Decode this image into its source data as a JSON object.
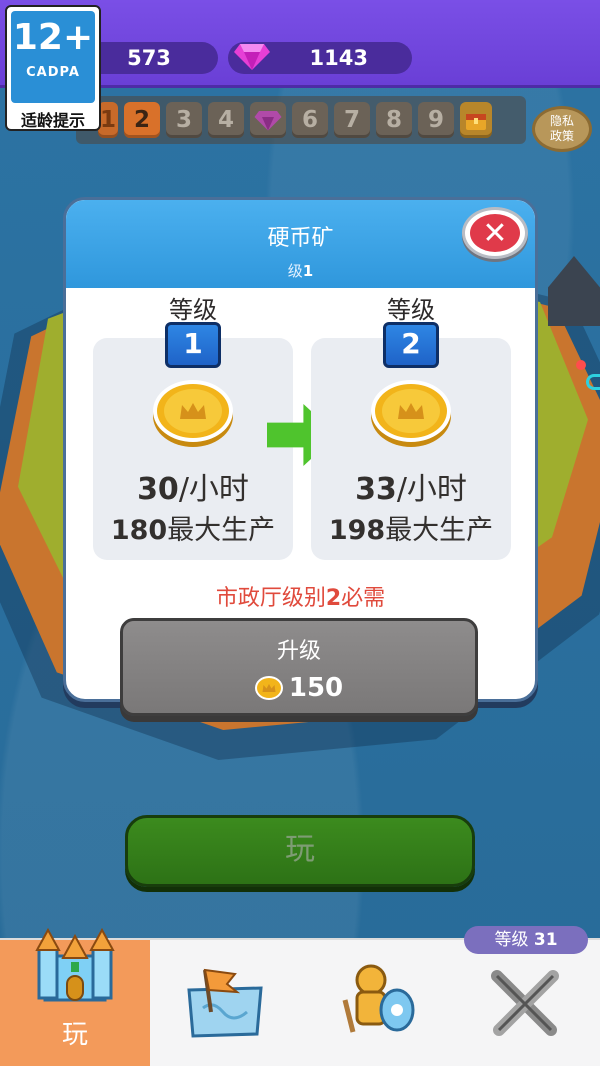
{
  "age_rating": {
    "number": "12+",
    "org": "CADPA",
    "tip": "适龄提示"
  },
  "resources": {
    "coins": "573",
    "gems": "1143"
  },
  "level_strip": {
    "cells": [
      "1",
      "2",
      "3",
      "4",
      "",
      "6",
      "7",
      "8",
      "9",
      ""
    ],
    "current": "2",
    "gem_cell_icon": "gem-icon",
    "chest_cell_icon": "chest-icon"
  },
  "privacy_button": "隐私政策",
  "modal": {
    "title": "硬币矿",
    "subtitle_prefix": "级",
    "subtitle_level": "1",
    "current": {
      "label": "等级",
      "level": "1",
      "rate_value": "30",
      "rate_unit": "/小时",
      "max_value": "180",
      "max_label": "最大生产"
    },
    "next": {
      "label": "等级",
      "level": "2",
      "rate_value": "33",
      "rate_unit": "/小时",
      "max_value": "198",
      "max_label": "最大生产"
    },
    "requirement_prefix": "市政厅级别",
    "requirement_level": "2",
    "requirement_suffix": "必需",
    "upgrade_label": "升级",
    "upgrade_cost": "150",
    "close_icon": "close-icon"
  },
  "play_button": "玩",
  "player_level": {
    "prefix": "等级",
    "value": "31"
  },
  "nav": [
    {
      "name": "castle",
      "label": "玩",
      "icon": "castle-icon",
      "active": true
    },
    {
      "name": "map",
      "label": "",
      "icon": "map-flag-icon",
      "active": false
    },
    {
      "name": "hero",
      "label": "",
      "icon": "knight-shield-icon",
      "active": false
    },
    {
      "name": "battle",
      "label": "",
      "icon": "crossed-swords-icon",
      "active": false
    }
  ],
  "colors": {
    "top_bar": "#7a4fe6",
    "modal_header": "#2f97dc",
    "requirement_text": "#e04a3c",
    "play_button": "#2d7216",
    "active_tab": "#f39a5a",
    "coin": "#f2b41a"
  }
}
